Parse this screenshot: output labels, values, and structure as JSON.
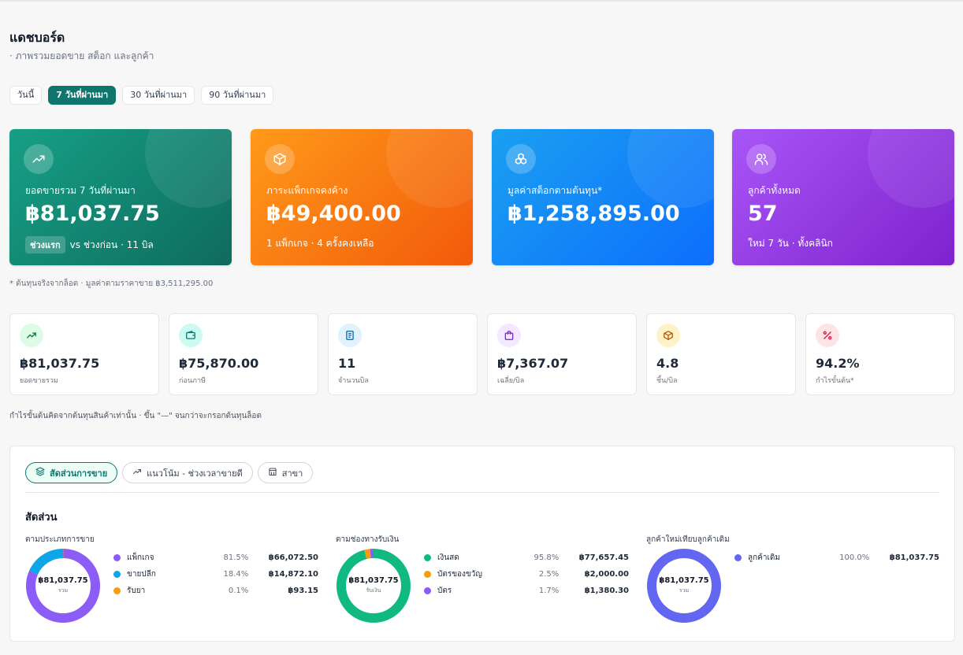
{
  "header": {
    "title": "แดชบอร์ด",
    "subtitle": "· ภาพรวมยอดขาย สต็อก และลูกค้า"
  },
  "ranges": [
    {
      "label": "วันนี้",
      "active": false
    },
    {
      "label": "7 วันที่ผ่านมา",
      "active": true
    },
    {
      "label": "30 วันที่ผ่านมา",
      "active": false
    },
    {
      "label": "90 วันที่ผ่านมา",
      "active": false
    }
  ],
  "hero": [
    {
      "icon": "trending-up-icon",
      "label": "ยอดขายรวม 7 วันที่ผ่านมา",
      "value": "฿81,037.75",
      "chip": "ช่วงแรก",
      "foot": "vs ช่วงก่อน · 11 บิล",
      "color": "#0f766e"
    },
    {
      "icon": "package-icon",
      "label": "ภาระแพ็กเกจคงค้าง",
      "value": "฿49,400.00",
      "chip": "",
      "foot": "1 แพ็กเกจ · 4 ครั้งคงเหลือ",
      "color": "#f97316"
    },
    {
      "icon": "boxes-icon",
      "label": "มูลค่าสต็อกตามต้นทุน*",
      "value": "฿1,258,895.00",
      "chip": "",
      "foot": "",
      "color": "#0d6efd"
    },
    {
      "icon": "users-icon",
      "label": "ลูกค้าทั้งหมด",
      "value": "57",
      "chip": "",
      "foot": "ใหม่ 7 วัน · ทั้งคลินิก",
      "color": "#9333ea"
    }
  ],
  "stock_note": "* ต้นทุนจริงจากล็อต · มูลค่าตามราคาขาย ฿3,511,295.00",
  "stats": [
    {
      "icon": "trending-up-icon",
      "value": "฿81,037.75",
      "label": "ยอดขายรวม",
      "bg": "#dcfce7",
      "fg": "#15803d"
    },
    {
      "icon": "wallet-icon",
      "value": "฿75,870.00",
      "label": "ก่อนภาษี",
      "bg": "#ccfbf1",
      "fg": "#0f766e"
    },
    {
      "icon": "receipt-icon",
      "value": "11",
      "label": "จำนวนบิล",
      "bg": "#e0f2fe",
      "fg": "#0369a1"
    },
    {
      "icon": "shopping-bag-icon",
      "value": "฿7,367.07",
      "label": "เฉลี่ย/บิล",
      "bg": "#f3e8ff",
      "fg": "#7e22ce"
    },
    {
      "icon": "box-icon",
      "value": "4.8",
      "label": "ชิ้น/บิล",
      "bg": "#fef3c7",
      "fg": "#b45309"
    },
    {
      "icon": "percent-icon",
      "value": "94.2%",
      "label": "กำไรขั้นต้น*",
      "bg": "#ffe4e6",
      "fg": "#e11d48"
    }
  ],
  "profit_note": "กำไรขั้นต้นคิดจากต้นทุนสินค้าเท่านั้น · ขึ้น \"—\" จนกว่าจะกรอกต้นทุนล็อต",
  "tabs": [
    {
      "icon": "layers-icon",
      "label": "สัดส่วนการขาย",
      "active": true
    },
    {
      "icon": "trending-up-icon",
      "label": "แนวโน้ม - ช่วงเวลาขายดี",
      "active": false
    },
    {
      "icon": "store-icon",
      "label": "สาขา",
      "active": false
    }
  ],
  "section_title": "สัดส่วน",
  "groups": [
    {
      "title": "ตามประเภทการขาย",
      "center_value": "฿81,037.75",
      "center_label": "รวม",
      "items": [
        {
          "name": "แพ็กเกจ",
          "pct": "81.5%",
          "share": 81.5,
          "amount": "฿66,072.50",
          "color": "#8b5cf6"
        },
        {
          "name": "ขายปลีก",
          "pct": "18.4%",
          "share": 18.4,
          "amount": "฿14,872.10",
          "color": "#0ea5e9"
        },
        {
          "name": "รับยา",
          "pct": "0.1%",
          "share": 0.1,
          "amount": "฿93.15",
          "color": "#f59e0b"
        }
      ]
    },
    {
      "title": "ตามช่องทางรับเงิน",
      "center_value": "฿81,037.75",
      "center_label": "รับเงิน",
      "items": [
        {
          "name": "เงินสด",
          "pct": "95.8%",
          "share": 95.8,
          "amount": "฿77,657.45",
          "color": "#10b981"
        },
        {
          "name": "บัตรของขวัญ",
          "pct": "2.5%",
          "share": 2.5,
          "amount": "฿2,000.00",
          "color": "#f59e0b"
        },
        {
          "name": "บัตร",
          "pct": "1.7%",
          "share": 1.7,
          "amount": "฿1,380.30",
          "color": "#8b5cf6"
        }
      ]
    },
    {
      "title": "ลูกค้าใหม่เทียบลูกค้าเดิม",
      "center_value": "฿81,037.75",
      "center_label": "รวม",
      "items": [
        {
          "name": "ลูกค้าเดิม",
          "pct": "100.0%",
          "share": 100.0,
          "amount": "฿81,037.75",
          "color": "#6366f1"
        }
      ]
    }
  ]
}
